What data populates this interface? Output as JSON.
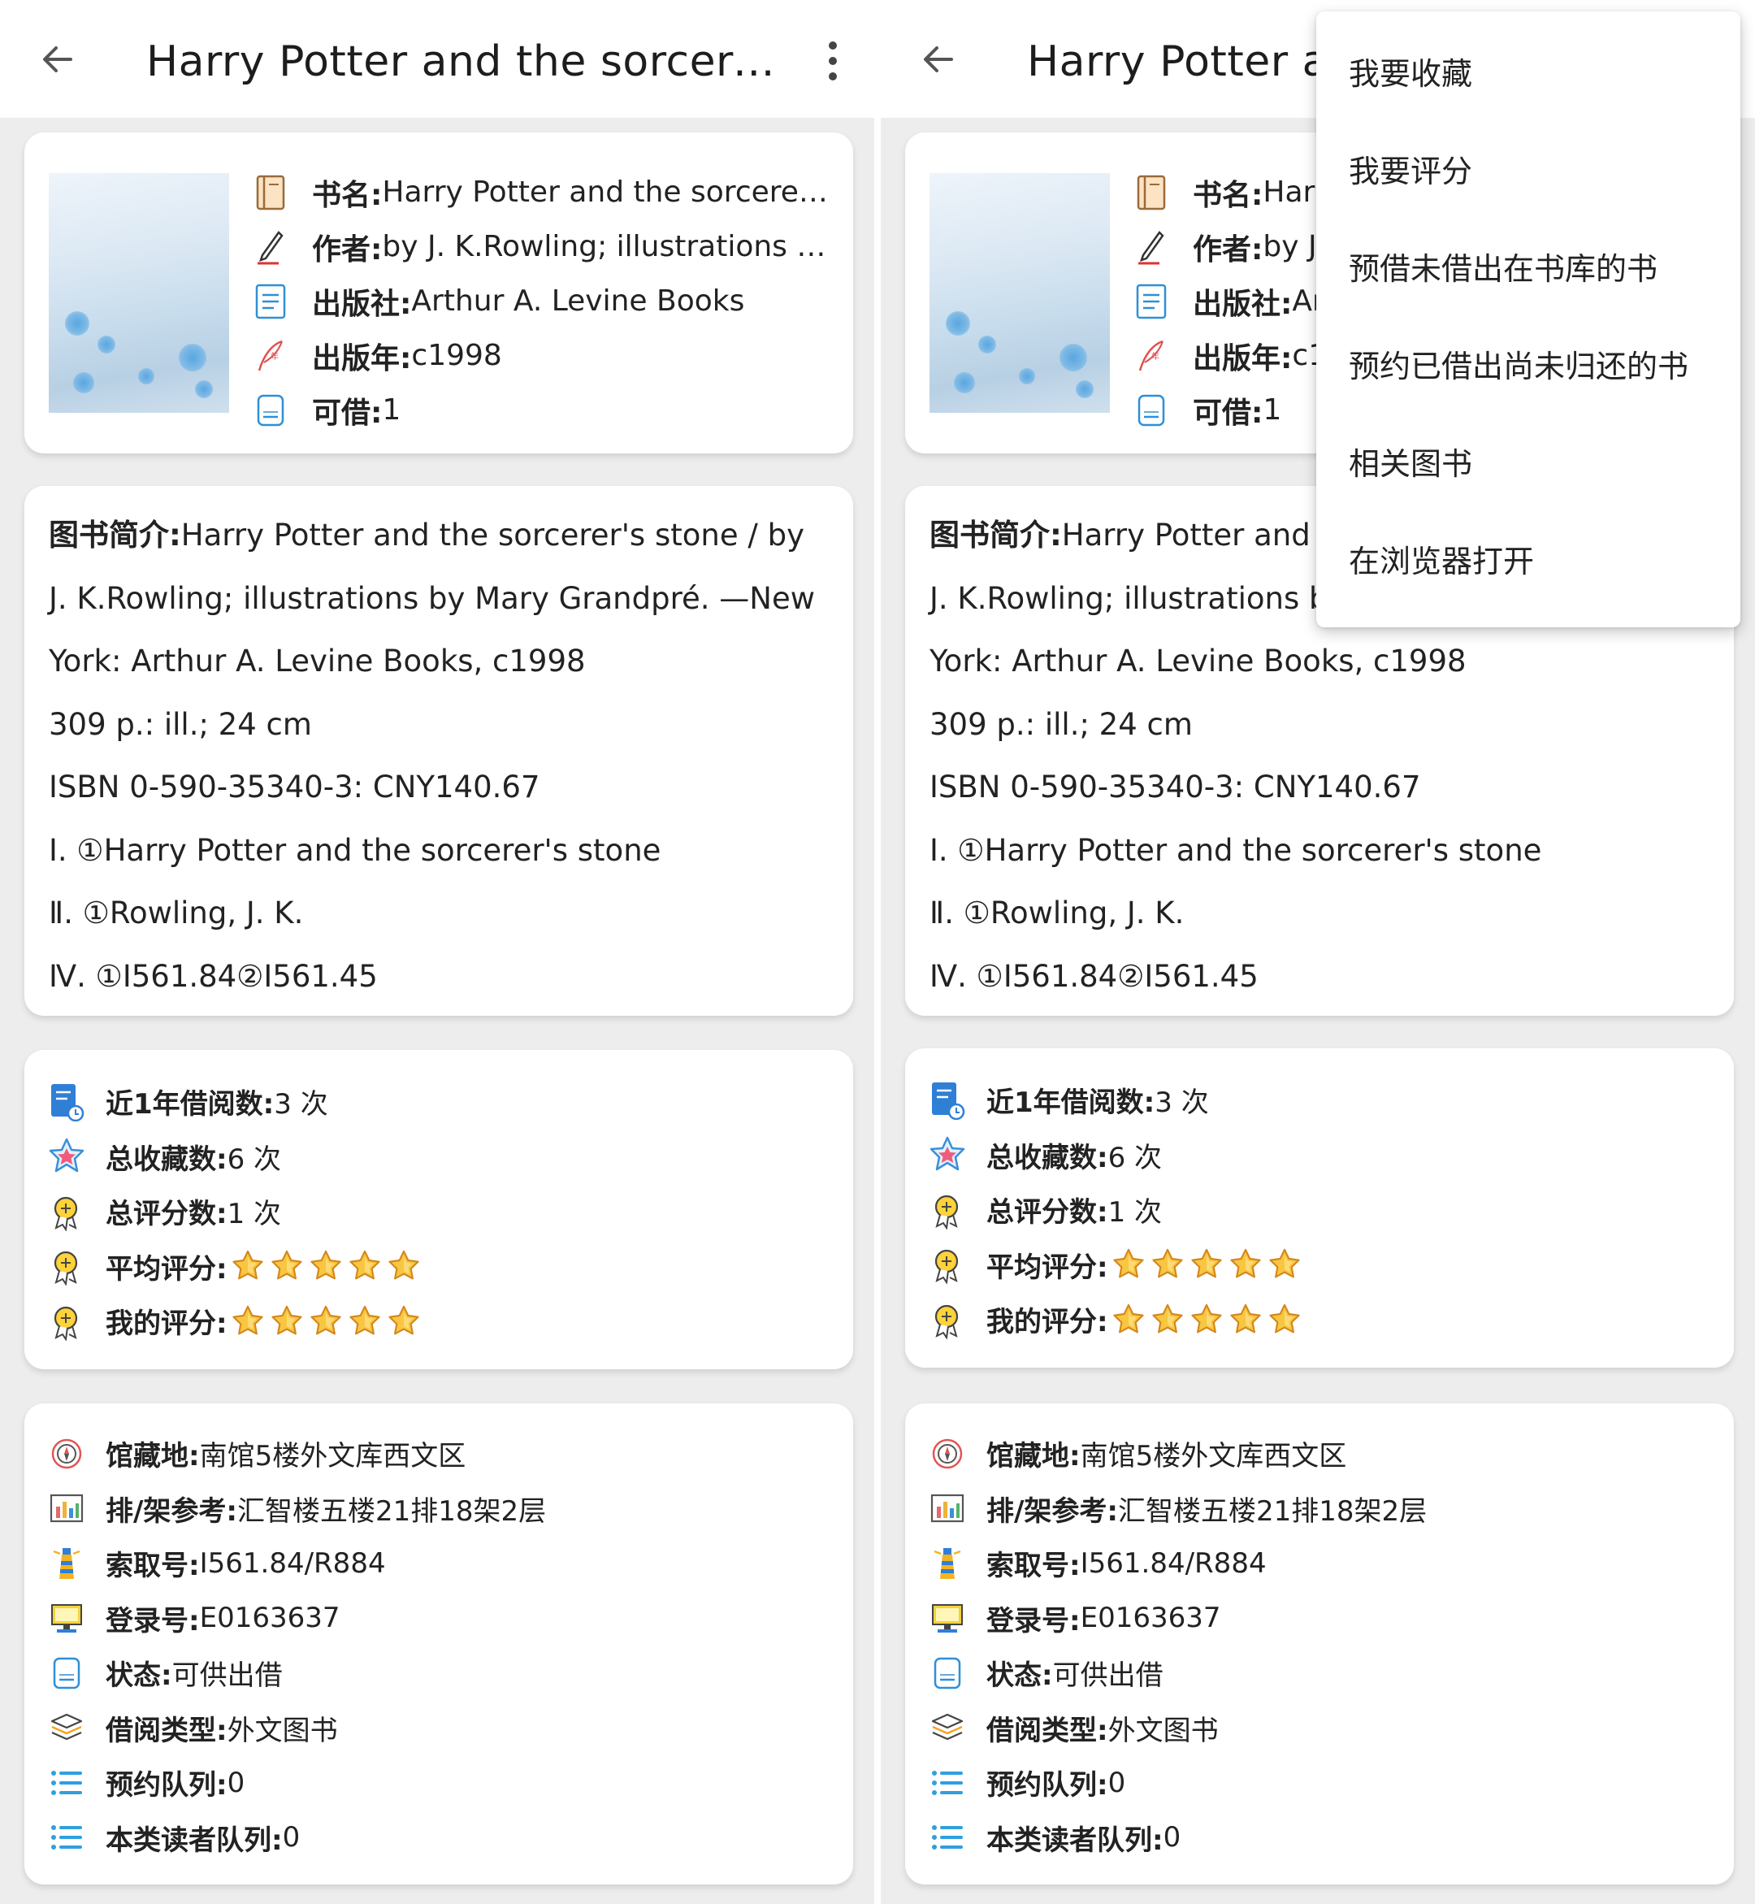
{
  "app": {
    "title": "Harry Potter and the sorcerer's stone",
    "title_right_visible": "Harry Potter ar"
  },
  "book": {
    "fields": [
      {
        "label": "书名:",
        "value": "Harry Potter and the sorcerer's stone",
        "icon": "book-cover-icon"
      },
      {
        "label": "作者:",
        "value": "by J. K.Rowling; illustrations by Mary Grandpré",
        "icon": "pen-icon"
      },
      {
        "label": "出版社:",
        "value": "Arthur A. Levine Books",
        "icon": "document-icon"
      },
      {
        "label": "出版年:",
        "value": "c1998",
        "icon": "quill-calendar-icon"
      },
      {
        "label": "可借:",
        "value": "1",
        "icon": "tablet-icon"
      }
    ],
    "fields_right": [
      {
        "label": "书名:",
        "value": "Harr"
      },
      {
        "label": "作者:",
        "value": "by J"
      },
      {
        "label": "出版社:",
        "value": "Ar"
      },
      {
        "label": "出版年:",
        "value": "c1"
      },
      {
        "label": "可借:",
        "value": "1"
      }
    ]
  },
  "description": {
    "label": "图书简介:",
    "first_line": "Harry Potter and the sorcerer's stone / by",
    "first_line_right": "Harry Potter and",
    "lines": [
      "J. K.Rowling; illustrations by Mary Grandpré. —New",
      "York: Arthur A. Levine Books, c1998",
      "309 p.: ill.; 24 cm",
      "ISBN 0-590-35340-3: CNY140.67",
      " Ⅰ. ①Harry Potter and the sorcerer's stone",
      " Ⅱ. ①Rowling, J. K.",
      "Ⅳ. ①I561.84②I561.45"
    ],
    "line1_right": "J. K.Rowling; illustrations b"
  },
  "stats": {
    "rows": [
      {
        "label": "近1年借阅数:",
        "value": "3 次",
        "icon": "book-clock-icon"
      },
      {
        "label": "总收藏数:",
        "value": "6 次",
        "icon": "star-badge-icon"
      },
      {
        "label": "总评分数:",
        "value": "1 次",
        "icon": "award-ribbon-icon"
      }
    ],
    "avg_rating": {
      "label": "平均评分:",
      "stars": 5,
      "max": 5,
      "icon": "award-ribbon-icon"
    },
    "my_rating": {
      "label": "我的评分:",
      "stars": 5,
      "max": 5,
      "icon": "award-ribbon-icon"
    }
  },
  "holdings": {
    "rows": [
      {
        "label": "馆藏地:",
        "value": "南馆5楼外文库西文区",
        "icon": "compass-icon"
      },
      {
        "label": "排/架参考:",
        "value": "汇智楼五楼21排18架2层",
        "icon": "shelf-chart-icon"
      },
      {
        "label": "索取号:",
        "value": "I561.84/R884",
        "icon": "lighthouse-icon"
      },
      {
        "label": "登录号:",
        "value": "E0163637",
        "icon": "monitor-icon"
      },
      {
        "label": "状态:",
        "value": "可供出借",
        "icon": "tablet-icon"
      },
      {
        "label": "借阅类型:",
        "value": "外文图书",
        "icon": "layers-icon"
      },
      {
        "label": "预约队列:",
        "value": "0",
        "icon": "list-icon"
      },
      {
        "label": "本类读者队列:",
        "value": "0",
        "icon": "list-icon"
      }
    ]
  },
  "menu": {
    "items": [
      "我要收藏",
      "我要评分",
      "预借未借出在书库的书",
      "预约已借出尚未归还的书",
      "相关图书",
      "在浏览器打开"
    ]
  },
  "colors": {
    "accent_blue": "#2f7fd6",
    "star_gold": "#f4b321",
    "card_bg": "#ffffff",
    "page_bg": "#ededed"
  }
}
